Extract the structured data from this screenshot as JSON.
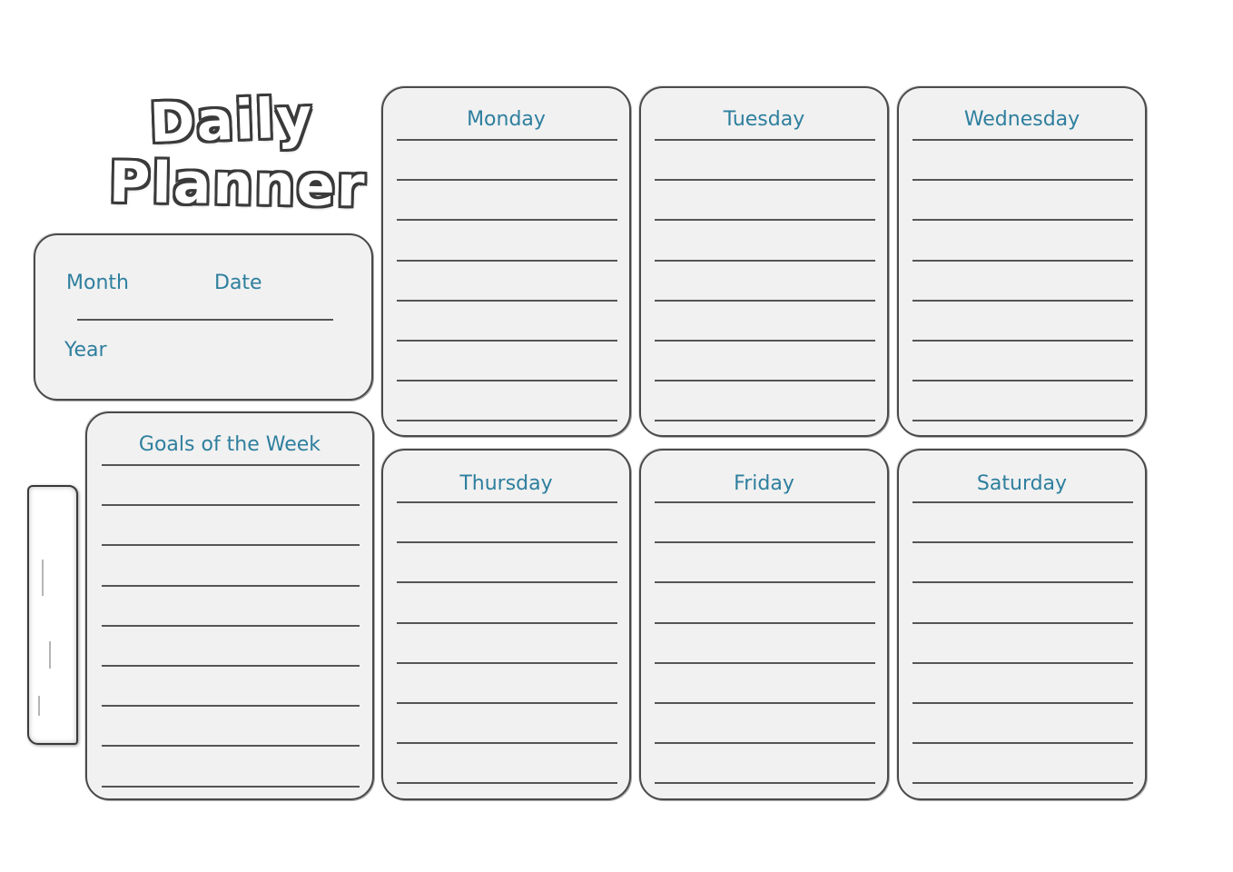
{
  "planner": {
    "title_line1": "Daily",
    "title_line2": "Planner",
    "info": {
      "month_label": "Month",
      "date_label": "Date",
      "year_label": "Year"
    },
    "goals_title": "Goals of the Week",
    "days": [
      {
        "label": "Monday"
      },
      {
        "label": "Tuesday"
      },
      {
        "label": "Wednesday"
      },
      {
        "label": "Thursday"
      },
      {
        "label": "Friday"
      },
      {
        "label": "Saturday"
      }
    ],
    "colors": {
      "accent_text": "#2e7f9e",
      "card_fill": "#f1f1f1",
      "line": "#555555"
    }
  }
}
